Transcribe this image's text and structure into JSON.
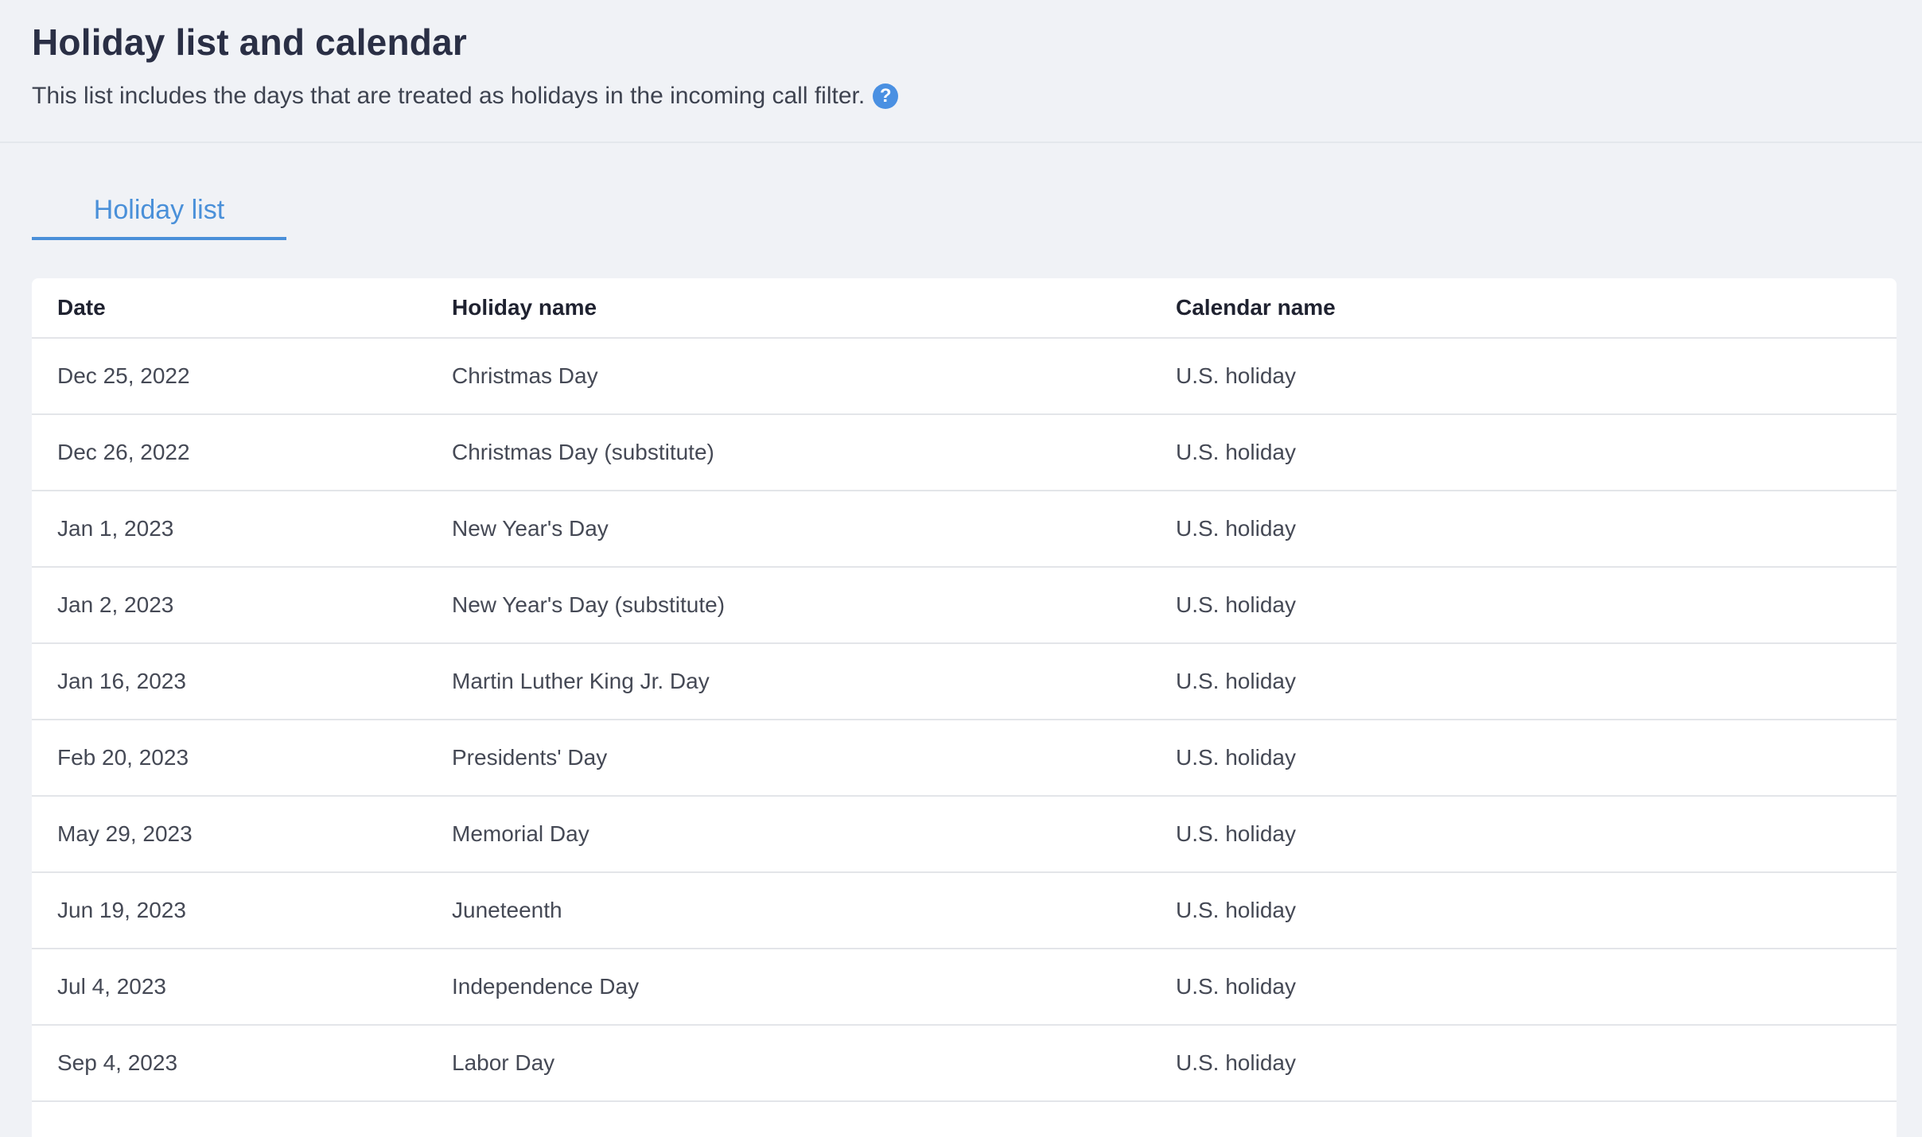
{
  "header": {
    "title": "Holiday list and calendar",
    "description": "This list includes the days that are treated as holidays in the incoming call filter.",
    "help_icon": "?"
  },
  "tabs": [
    {
      "label": "Holiday list",
      "active": true
    }
  ],
  "table": {
    "columns": [
      "Date",
      "Holiday name",
      "Calendar name"
    ],
    "rows": [
      [
        "Dec 25, 2022",
        "Christmas Day",
        "U.S. holiday"
      ],
      [
        "Dec 26, 2022",
        "Christmas Day (substitute)",
        "U.S. holiday"
      ],
      [
        "Jan 1, 2023",
        "New Year's Day",
        "U.S. holiday"
      ],
      [
        "Jan 2, 2023",
        "New Year's Day (substitute)",
        "U.S. holiday"
      ],
      [
        "Jan 16, 2023",
        "Martin Luther King Jr. Day",
        "U.S. holiday"
      ],
      [
        "Feb 20, 2023",
        "Presidents' Day",
        "U.S. holiday"
      ],
      [
        "May 29, 2023",
        "Memorial Day",
        "U.S. holiday"
      ],
      [
        "Jun 19, 2023",
        "Juneteenth",
        "U.S. holiday"
      ],
      [
        "Jul 4, 2023",
        "Independence Day",
        "U.S. holiday"
      ],
      [
        "Sep 4, 2023",
        "Labor Day",
        "U.S. holiday"
      ]
    ]
  },
  "colors": {
    "accent": "#4a90d9",
    "background": "#f0f2f6",
    "title": "#2a2f45"
  }
}
